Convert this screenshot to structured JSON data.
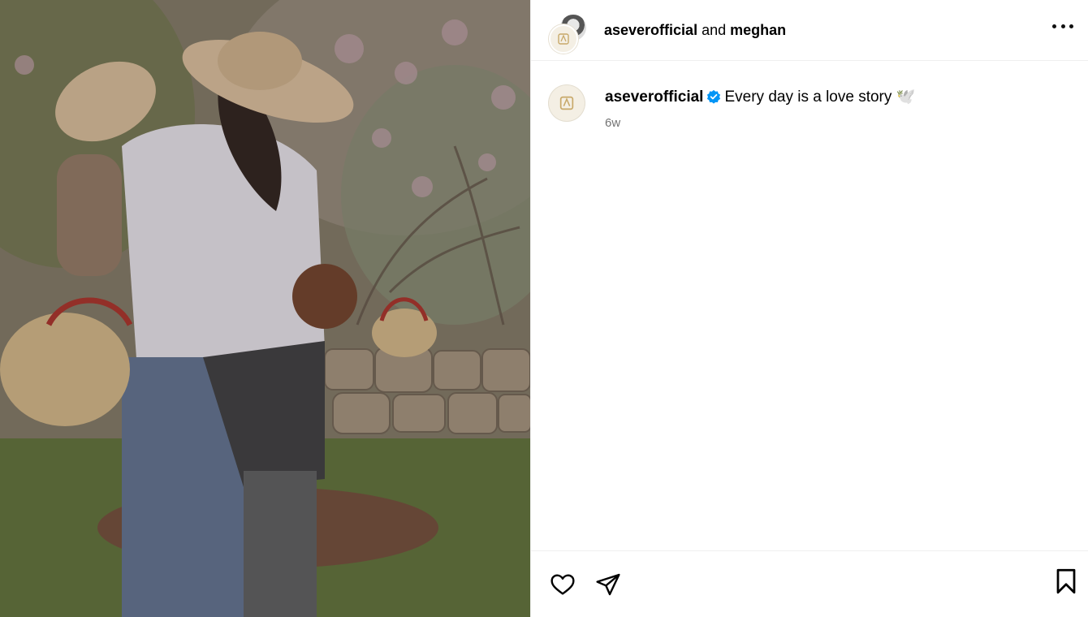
{
  "header": {
    "owner": "aseverofficial",
    "conjunction": "and",
    "collaborator": "meghan",
    "more_icon": "more-horizontal-icon"
  },
  "caption": {
    "username": "aseverofficial",
    "verified_icon": "verified-badge-icon",
    "text": "Every day is a love story",
    "emoji": "🕊️",
    "timestamp": "6w"
  },
  "actions": {
    "like_icon": "heart-icon",
    "share_icon": "paper-plane-icon",
    "save_icon": "bookmark-icon"
  },
  "colors": {
    "verified": "#0095f6",
    "secondary_text": "#737373",
    "divider": "#efefef"
  }
}
